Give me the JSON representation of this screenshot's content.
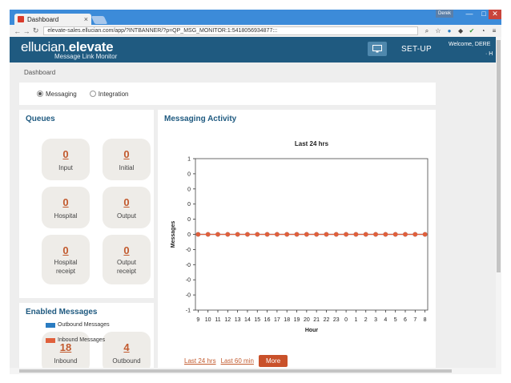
{
  "browser": {
    "tab_title": "Dashboard",
    "tab_close": "×",
    "user_badge": "Derek",
    "url": "elevate-sales.ellucian.com/app/?INTBANNER/?p=QP_MSG_MONITOR:1:5418056934877:::",
    "win_min": "—",
    "win_max": "□",
    "win_close": "✕"
  },
  "header": {
    "brand_light": "ellucian.",
    "brand_bold": "elevate",
    "subtitle": "Message Link Monitor",
    "setup_label": "SET-UP",
    "welcome": "Welcome, DERE",
    "welcome_suffix": "· H"
  },
  "breadcrumb": "Dashboard",
  "view_toggle": {
    "messaging": "Messaging",
    "integration": "Integration",
    "selected": "Messaging"
  },
  "queues": {
    "title": "Queues",
    "tiles": [
      {
        "value": "0",
        "label": "Input"
      },
      {
        "value": "0",
        "label": "Initial"
      },
      {
        "value": "0",
        "label": "Hospital"
      },
      {
        "value": "0",
        "label": "Output"
      },
      {
        "value": "0",
        "label": "Hospital",
        "label2": "receipt"
      },
      {
        "value": "0",
        "label": "Output",
        "label2": "receipt"
      }
    ]
  },
  "enabled_messages": {
    "title": "Enabled Messages",
    "tiles": [
      {
        "value": "18",
        "label": "Inbound"
      },
      {
        "value": "4",
        "label": "Outbound"
      }
    ]
  },
  "activity": {
    "title": "Messaging Activity",
    "links": {
      "last24": "Last 24 hrs",
      "last60": "Last 60 min",
      "more": "More"
    }
  },
  "colors": {
    "header_bg": "#1f5a80",
    "accent": "#c25a2e",
    "outbound": "#2a7cc1",
    "inbound": "#e0603c"
  },
  "chart_data": {
    "type": "line",
    "title": "Last 24 hrs",
    "xlabel": "Hour",
    "ylabel": "Messages",
    "categories": [
      "9",
      "10",
      "11",
      "12",
      "13",
      "14",
      "15",
      "16",
      "17",
      "18",
      "19",
      "20",
      "21",
      "22",
      "23",
      "0",
      "1",
      "2",
      "3",
      "4",
      "5",
      "6",
      "7",
      "8"
    ],
    "yticks": [
      "1",
      "0",
      "0",
      "0",
      "0",
      "0",
      "-0",
      "-0",
      "-0",
      "-0",
      "-1"
    ],
    "ylim": [
      -1,
      1
    ],
    "legend": "bottom-left",
    "series": [
      {
        "name": "Outbound Messages",
        "color": "#2a7cc1",
        "values": [
          0,
          0,
          0,
          0,
          0,
          0,
          0,
          0,
          0,
          0,
          0,
          0,
          0,
          0,
          0,
          0,
          0,
          0,
          0,
          0,
          0,
          0,
          0,
          0
        ]
      },
      {
        "name": "Inbound Messages",
        "color": "#e0603c",
        "values": [
          0,
          0,
          0,
          0,
          0,
          0,
          0,
          0,
          0,
          0,
          0,
          0,
          0,
          0,
          0,
          0,
          0,
          0,
          0,
          0,
          0,
          0,
          0,
          0
        ]
      }
    ]
  }
}
